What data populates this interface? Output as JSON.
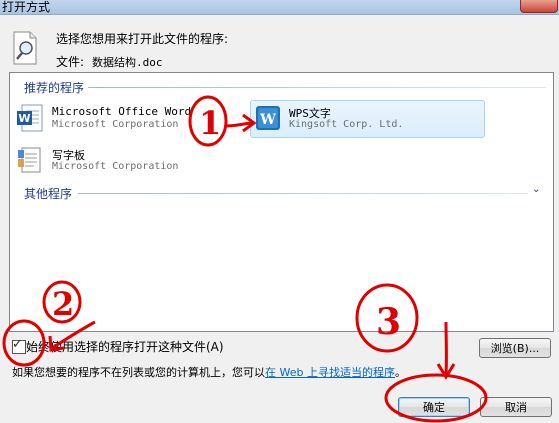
{
  "window": {
    "title": "打开方式"
  },
  "header": {
    "prompt": "选择您想用来打开此文件的程序:",
    "file_label": "文件:",
    "file_name": "数据结构.doc"
  },
  "sections": {
    "recommended": "推荐的程序",
    "other": "其他程序"
  },
  "programs": [
    {
      "name": "Microsoft Office Word",
      "publisher": "Microsoft Corporation"
    },
    {
      "name": "WPS文字",
      "publisher": "Kingsoft Corp. Ltd."
    },
    {
      "name": "写字板",
      "publisher": "Microsoft Corporation"
    }
  ],
  "footer": {
    "always_use_label": "始终使用选择的程序打开这种文件(A)",
    "always_use_checked": true,
    "browse_label": "浏览(B)...",
    "info_prefix": "如果您想要的程序不在列表或您的计算机上，您可以",
    "info_link": "在 Web 上寻找适当的程序",
    "info_suffix": "。",
    "ok_label": "确定",
    "cancel_label": "取消"
  },
  "annotations": [
    "1",
    "2",
    "3"
  ],
  "colors": {
    "annotation": "#e00000",
    "link": "#0066cc",
    "section_header": "#1e3d8f"
  }
}
